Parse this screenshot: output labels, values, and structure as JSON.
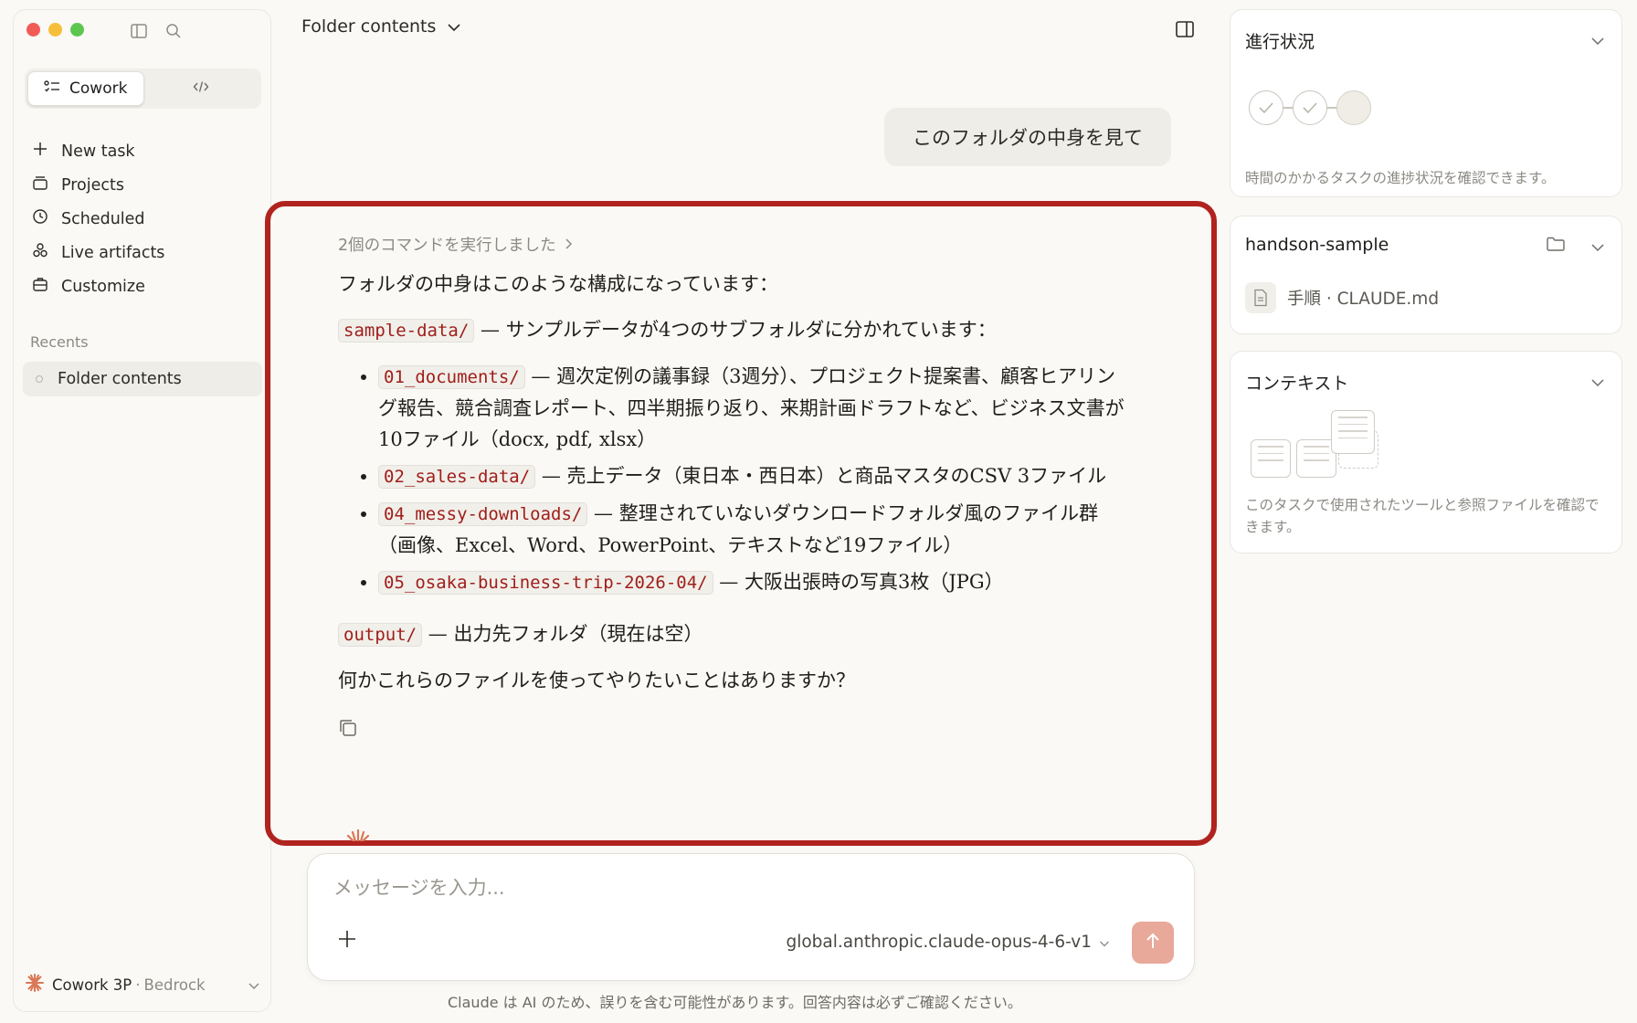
{
  "sidebar": {
    "mode_tabs": [
      {
        "label": "Cowork",
        "icon": "cowork-icon",
        "active": true
      },
      {
        "label": "",
        "icon": "code-icon",
        "active": false
      }
    ],
    "nav": [
      {
        "label": "New task",
        "icon": "plus-icon"
      },
      {
        "label": "Projects",
        "icon": "projects-icon"
      },
      {
        "label": "Scheduled",
        "icon": "clock-icon"
      },
      {
        "label": "Live artifacts",
        "icon": "artifacts-icon"
      },
      {
        "label": "Customize",
        "icon": "briefcase-icon"
      }
    ],
    "recents_label": "Recents",
    "recents": [
      {
        "label": "Folder contents"
      }
    ],
    "account": {
      "name": "Cowork 3P",
      "separator": "·",
      "provider": "Bedrock"
    }
  },
  "header": {
    "title": "Folder contents"
  },
  "conversation": {
    "user_message": "このフォルダの中身を見て",
    "commands_toggle": "2個のコマンドを実行しました",
    "intro": "フォルダの中身はこのような構成になっています：",
    "sample_dir": "sample-data/",
    "sample_desc": "— サンプルデータが4つのサブフォルダに分かれています：",
    "subfolders": [
      {
        "name": "01_documents/",
        "desc": "— 週次定例の議事録（3週分）、プロジェクト提案書、顧客ヒアリング報告、競合調査レポート、四半期振り返り、来期計画ドラフトなど、ビジネス文書が10ファイル（docx, pdf, xlsx）"
      },
      {
        "name": "02_sales-data/",
        "desc": "— 売上データ（東日本・西日本）と商品マスタのCSV 3ファイル"
      },
      {
        "name": "04_messy-downloads/",
        "desc": "— 整理されていないダウンロードフォルダ風のファイル群（画像、Excel、Word、PowerPoint、テキストなど19ファイル）"
      },
      {
        "name": "05_osaka-business-trip-2026-04/",
        "desc": "— 大阪出張時の写真3枚（JPG）"
      }
    ],
    "output_dir": "output/",
    "output_desc": "— 出力先フォルダ（現在は空）",
    "question": "何かこれらのファイルを使ってやりたいことはありますか？"
  },
  "composer": {
    "placeholder": "メッセージを入力...",
    "model": "global.anthropic.claude-opus-4-6-v1",
    "disclaimer": "Claude は AI のため、誤りを含む可能性があります。回答内容は必ずご確認ください。"
  },
  "right_panel": {
    "progress": {
      "title": "進行状況",
      "steps": [
        "done",
        "done",
        "pending"
      ],
      "description": "時間のかかるタスクの進捗状況を確認できます。"
    },
    "folder": {
      "title": "handson-sample",
      "file": "手順 · CLAUDE.md"
    },
    "context": {
      "title": "コンテキスト",
      "description": "このタスクで使用されたツールと参照ファイルを確認できます。"
    }
  },
  "colors": {
    "accent": "#b0231f",
    "send_button": "#e8a89a",
    "code_text": "#a01e1a"
  }
}
